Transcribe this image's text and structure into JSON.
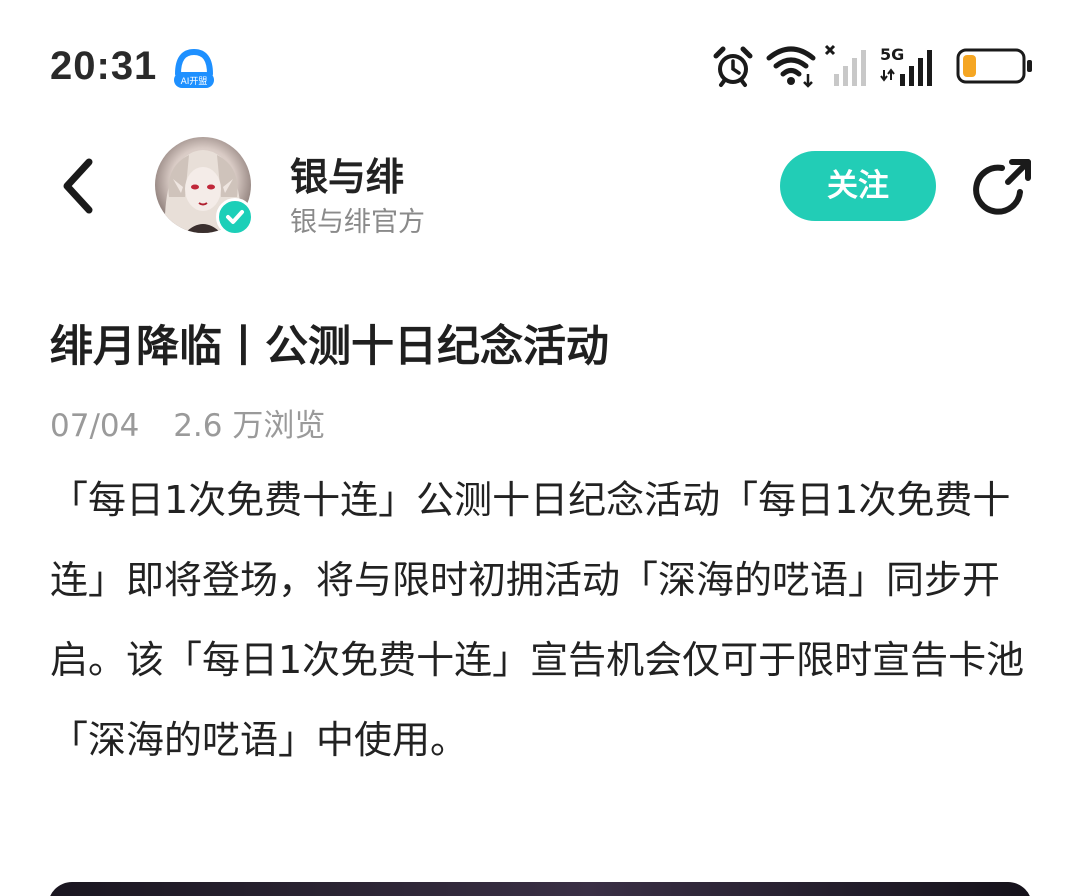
{
  "status_bar": {
    "time": "20:31",
    "ai_badge_label": "AI开盟",
    "network_label": "5G",
    "icons": [
      "alarm-icon",
      "wifi-icon",
      "signal-icon-1",
      "signal-icon-2",
      "battery-icon"
    ],
    "battery_color": "#f5a623"
  },
  "header": {
    "author_name": "银与绯",
    "author_subtitle": "银与绯官方",
    "follow_label": "关注",
    "accent_color": "#22cdb6"
  },
  "article": {
    "title": "绯月降临丨公测十日纪念活动",
    "date": "07/04",
    "views": "2.6 万浏览",
    "body": "「每日1次免费十连」公测十日纪念活动「每日1次免费十连」即将登场，将与限时初拥活动「深海的呓语」同步开启。该「每日1次免费十连」宣告机会仅可于限时宣告卡池「深海的呓语」中使用。"
  }
}
